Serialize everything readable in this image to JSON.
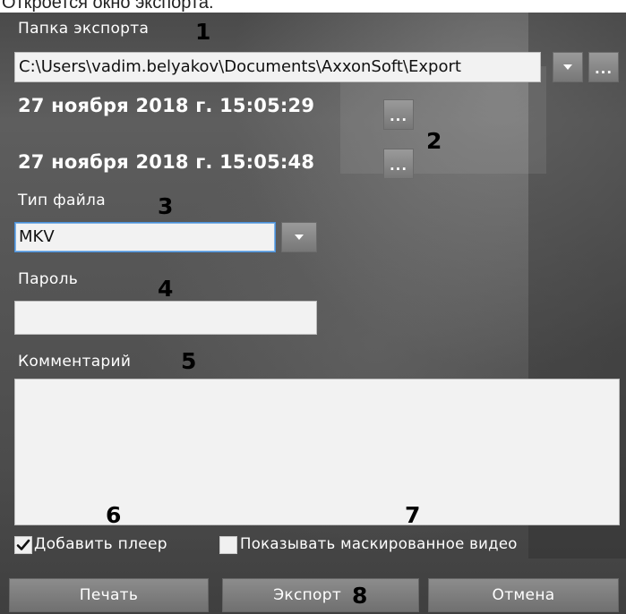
{
  "caption": "Откроется окно экспорта.",
  "export_folder": {
    "label": "Папка экспорта",
    "value": "C:\\Users\\vadim.belyakov\\Documents\\AxxonSoft\\Export"
  },
  "dates": {
    "start": "27 ноября 2018 г. 15:05:29",
    "end": "27 ноября 2018 г. 15:05:48",
    "picker_label": "..."
  },
  "file_type": {
    "label": "Тип файла",
    "value": "MKV"
  },
  "password": {
    "label": "Пароль",
    "value": ""
  },
  "comment": {
    "label": "Комментарий",
    "value": ""
  },
  "options": {
    "add_player": {
      "label": "Добавить плеер",
      "checked": true
    },
    "show_masked": {
      "label": "Показывать маскированное видео",
      "checked": false
    }
  },
  "buttons": {
    "print": "Печать",
    "export": "Экспорт",
    "cancel": "Отмена"
  },
  "callouts": [
    "1",
    "2",
    "3",
    "4",
    "5",
    "6",
    "7",
    "8"
  ],
  "browse_label": "..."
}
